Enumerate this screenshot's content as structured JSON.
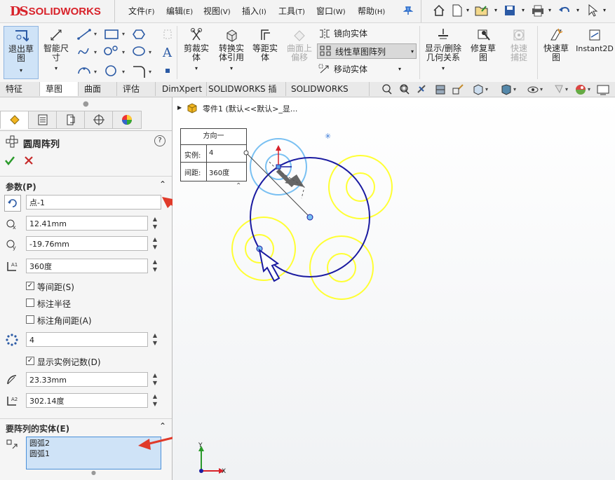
{
  "app": {
    "logo_ds": "DS",
    "logo_text": "SOLIDWORKS"
  },
  "menu": [
    {
      "label": "文件",
      "key": "(F)"
    },
    {
      "label": "编辑",
      "key": "(E)"
    },
    {
      "label": "视图",
      "key": "(V)"
    },
    {
      "label": "插入",
      "key": "(I)"
    },
    {
      "label": "工具",
      "key": "(T)"
    },
    {
      "label": "窗口",
      "key": "(W)"
    },
    {
      "label": "帮助",
      "key": "(H)"
    }
  ],
  "ribbon": {
    "exit_sketch": "退出草图",
    "smart_dim": "智能尺寸",
    "trim": "剪裁实体",
    "convert": "转换实体引用",
    "offset": "等距实体",
    "surface_offset": "曲面上偏移",
    "mirror": "镜向实体",
    "linear_pattern": "线性草图阵列",
    "move": "移动实体",
    "show_delete": "显示/删除几何关系",
    "repair": "修复草图",
    "quick_snap": "快速捕捉",
    "rapid_sketch": "快速草图",
    "instant2d": "Instant2D"
  },
  "tabs": [
    "特征",
    "草图",
    "曲面",
    "评估",
    "DimXpert",
    "SOLIDWORKS 插件",
    "SOLIDWORKS MBD"
  ],
  "active_tab": "草图",
  "panel": {
    "title": "圆周阵列",
    "help": "?",
    "params_header": "参数(P)",
    "center_point": "点-1",
    "x_value": "12.41mm",
    "y_value": "-19.76mm",
    "angle": "360度",
    "equal_spacing": "等间距(S)",
    "dim_radius": "标注半径",
    "dim_angle": "标注角间距(A)",
    "instances": "4",
    "show_count": "显示实例记数(D)",
    "radius": "23.33mm",
    "arc_angle": "302.14度",
    "entities_header": "要阵列的实体(E)",
    "entities": [
      "圆弧2",
      "圆弧1"
    ]
  },
  "canvas": {
    "tree_label": "零件1  (默认<<默认>_显...",
    "table_header": "方向一",
    "instance_label": "实例:",
    "instance_value": "4",
    "spacing_label": "间距:",
    "spacing_value": "360度",
    "axis_y": "Y",
    "axis_x": "X"
  },
  "colors": {
    "accent_red": "#d8222a",
    "sketch_blue": "#1a1aa0",
    "preview_yellow": "#ffff33",
    "arrow_red": "#e03a2a",
    "selection_blue": "#cfe3f7"
  }
}
